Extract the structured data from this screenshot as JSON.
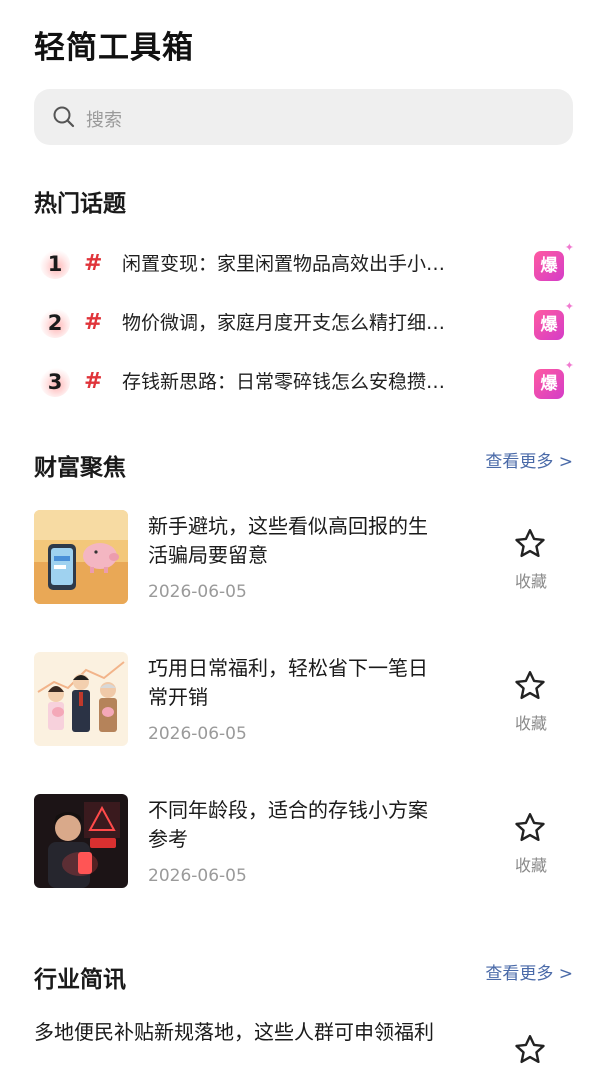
{
  "app": {
    "title": "轻简工具箱"
  },
  "search": {
    "placeholder": "搜索",
    "icon": "search-icon"
  },
  "hot_topics": {
    "title": "热门话题",
    "hash": "#",
    "badge": "爆",
    "items": [
      {
        "rank": "1",
        "text": "闲置变现：家里闲置物品高效出手小…"
      },
      {
        "rank": "2",
        "text": "物价微调，家庭月度开支怎么精打细…"
      },
      {
        "rank": "3",
        "text": "存钱新思路：日常零碎钱怎么安稳攒…"
      }
    ]
  },
  "wealth": {
    "title": "财富聚焦",
    "see_more": "查看更多 >",
    "fav_label": "收藏",
    "articles": [
      {
        "title": "新手避坑，这些看似高回报的生活骗局要留意",
        "date": "2026-06-05",
        "thumb": "phone-piggybank-illustration"
      },
      {
        "title": "巧用日常福利，轻松省下一笔日常开销",
        "date": "2026-06-05",
        "thumb": "family-with-piggybank-illustration"
      },
      {
        "title": "不同年龄段，适合的存钱小方案参考",
        "date": "2026-06-05",
        "thumb": "man-looking-at-phone-warning-illustration"
      }
    ]
  },
  "industry": {
    "title": "行业简讯",
    "see_more": "查看更多 >",
    "items": [
      {
        "title": "多地便民补贴新规落地，这些人群可申领福利"
      }
    ]
  },
  "colors": {
    "accent_link": "#4a6aa8",
    "hash_red": "#e0343a",
    "badge_gradient_start": "#ff5aa0",
    "badge_gradient_end": "#d43cc8",
    "search_bg": "#efefef"
  }
}
